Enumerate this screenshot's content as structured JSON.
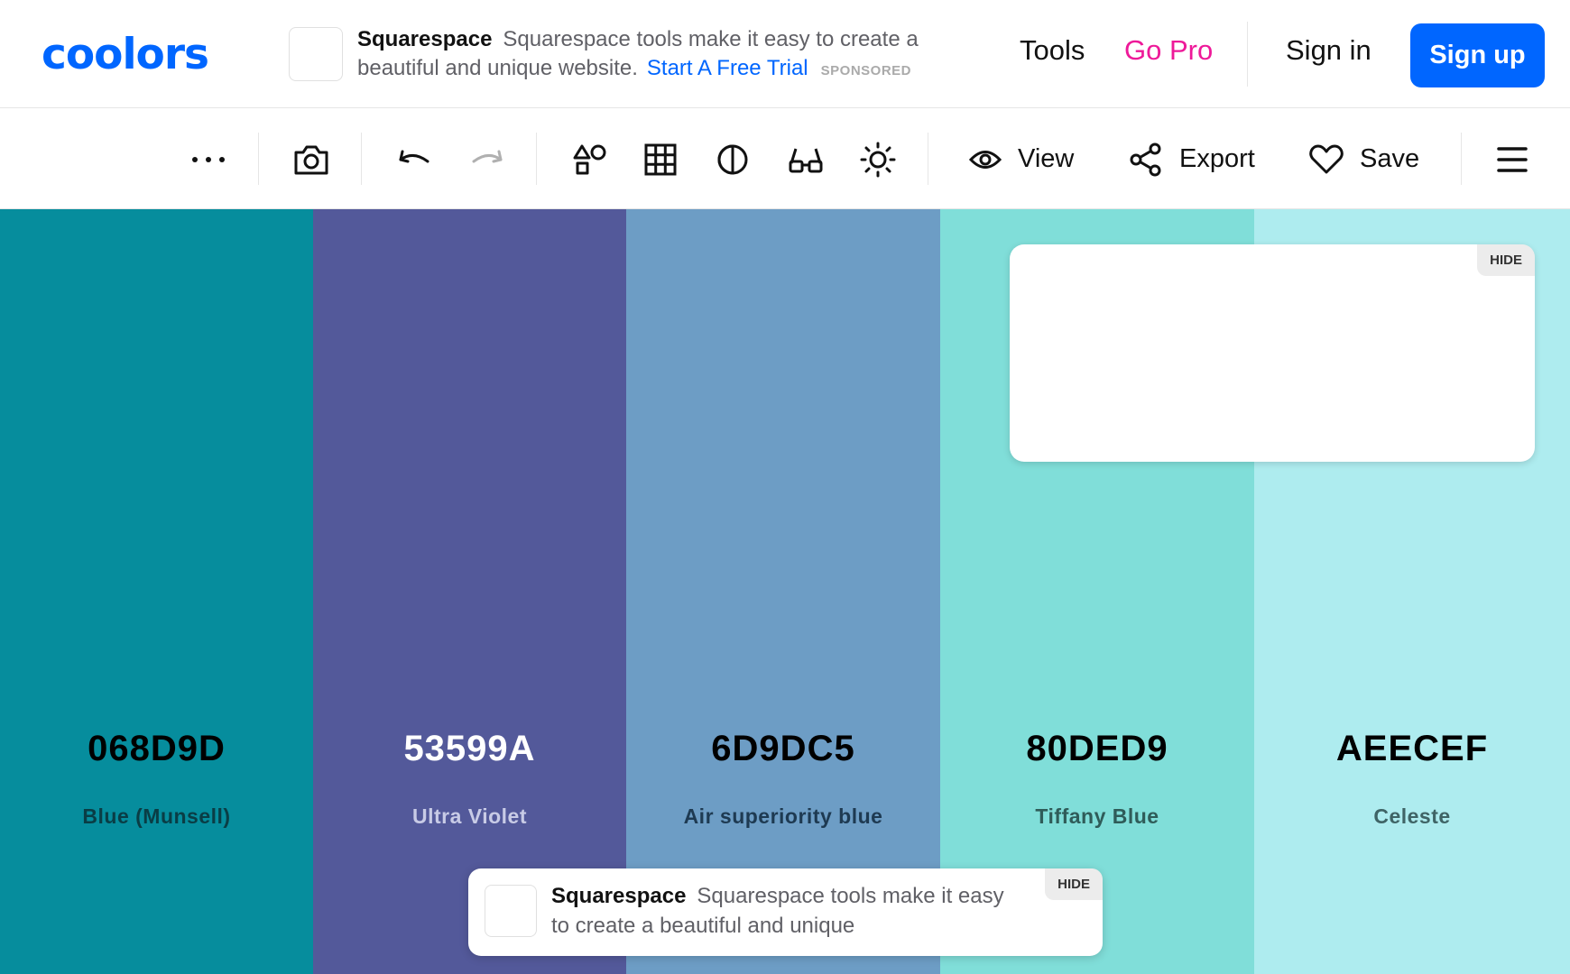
{
  "header": {
    "logo_text": "coolors",
    "ad": {
      "brand": "Squarespace",
      "text": "Squarespace tools make it easy to create a beautiful and unique website.",
      "link": "Start A Free Trial",
      "sponsored": "SPONSORED"
    },
    "nav": {
      "tools": "Tools",
      "go_pro": "Go Pro",
      "sign_in": "Sign in",
      "sign_up": "Sign up"
    }
  },
  "toolbar": {
    "view_label": "View",
    "export_label": "Export",
    "save_label": "Save"
  },
  "palette": {
    "colors": [
      {
        "hex": "068D9D",
        "name": "Blue (Munsell)",
        "bg": "#068D9D",
        "text_color": "#000000",
        "name_color": "#0a3d45"
      },
      {
        "hex": "53599A",
        "name": "Ultra Violet",
        "bg": "#53599A",
        "text_color": "#ffffff",
        "name_color": "#c8cbe6"
      },
      {
        "hex": "6D9DC5",
        "name": "Air superiority blue",
        "bg": "#6D9DC5",
        "text_color": "#000000",
        "name_color": "#1e3a52"
      },
      {
        "hex": "80DED9",
        "name": "Tiffany Blue",
        "bg": "#80DED9",
        "text_color": "#000000",
        "name_color": "#2f5c59"
      },
      {
        "hex": "AEECEF",
        "name": "Celeste",
        "bg": "#AEECEF",
        "text_color": "#000000",
        "name_color": "#3f6466"
      }
    ]
  },
  "overlay_ad": {
    "hide_label": "HIDE"
  },
  "bottom_ad": {
    "brand": "Squarespace",
    "text": "Squarespace tools make it easy to create a beautiful and unique",
    "hide_label": "HIDE"
  }
}
